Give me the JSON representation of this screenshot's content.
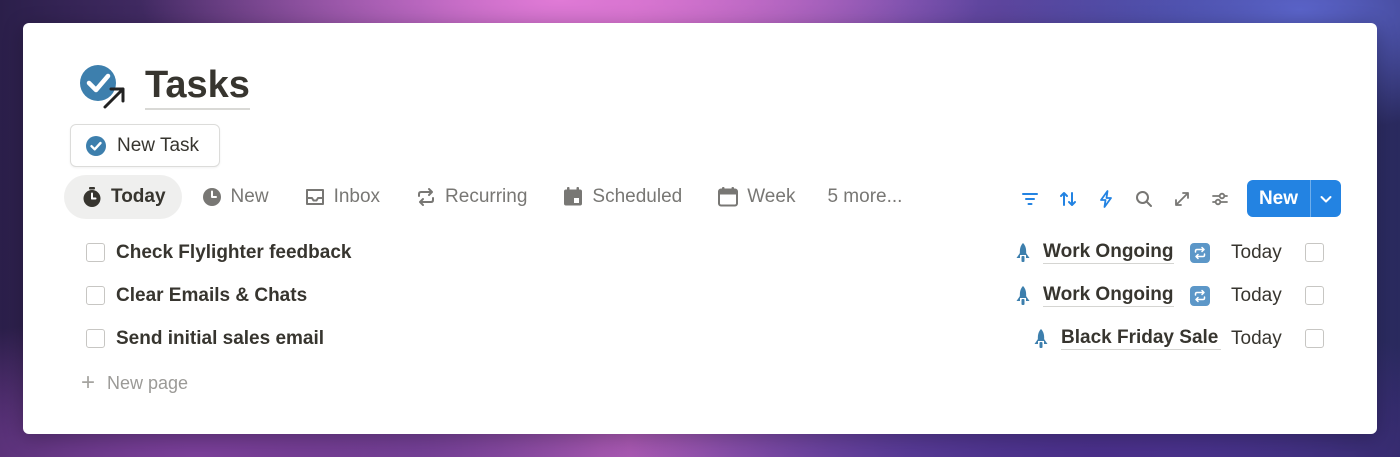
{
  "page": {
    "title": "Tasks",
    "icon": "check-circle-arrow-icon"
  },
  "new_task_button": {
    "label": "New Task",
    "icon": "check-circle-icon"
  },
  "tabs": [
    {
      "label": "Today",
      "icon": "stopwatch-icon",
      "active": true
    },
    {
      "label": "New",
      "icon": "clock-icon",
      "active": false
    },
    {
      "label": "Inbox",
      "icon": "inbox-tray-icon",
      "active": false
    },
    {
      "label": "Recurring",
      "icon": "repeat-icon",
      "active": false
    },
    {
      "label": "Scheduled",
      "icon": "calendar-day-icon",
      "active": false
    },
    {
      "label": "Week",
      "icon": "calendar-icon",
      "active": false
    }
  ],
  "more_tabs": "5 more...",
  "toolbar": {
    "icons": [
      "filter-icon",
      "sort-icon",
      "lightning-icon",
      "search-icon",
      "expand-icon",
      "settings-sliders-icon"
    ],
    "new_label": "New"
  },
  "tasks": [
    {
      "name": "Check Flylighter feedback",
      "project": "Work Ongoing",
      "recurring": true,
      "due": "Today",
      "done": false
    },
    {
      "name": "Clear Emails & Chats",
      "project": "Work Ongoing",
      "recurring": true,
      "due": "Today",
      "done": false
    },
    {
      "name": "Send initial sales email",
      "project": "Black Friday Sale :",
      "recurring": false,
      "due": "Today",
      "done": false
    }
  ],
  "new_page_label": "New page",
  "colors": {
    "accent": "#2383e2",
    "icon_blue": "#3d7fad",
    "text": "#37352f",
    "muted": "#787774"
  }
}
